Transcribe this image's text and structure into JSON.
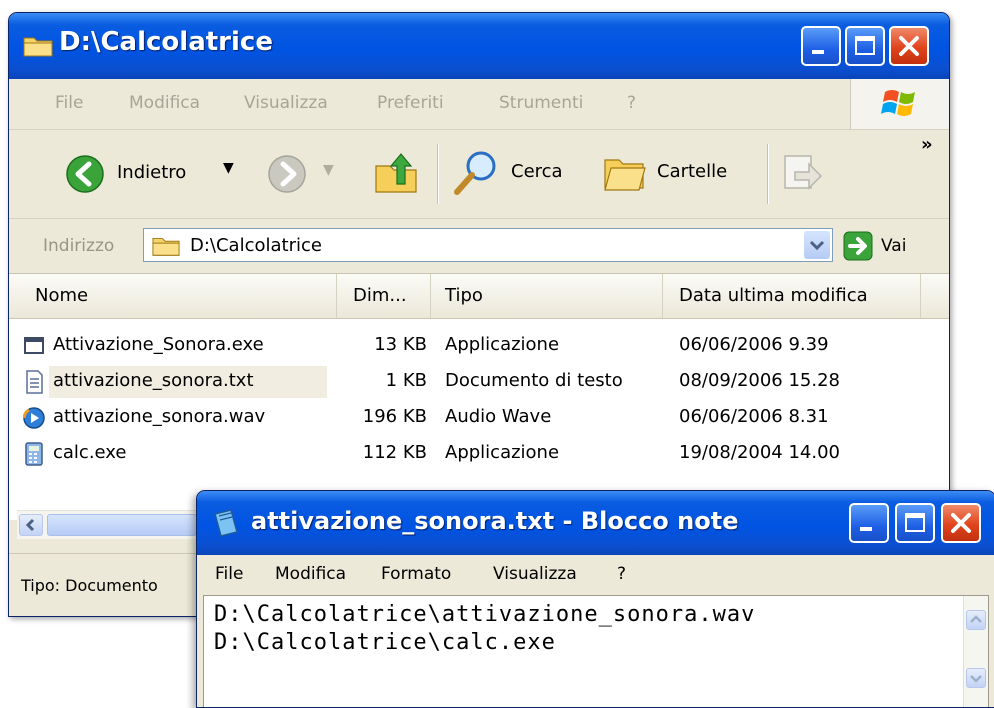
{
  "explorer": {
    "title": "D:\\Calcolatrice",
    "menu": [
      "File",
      "Modifica",
      "Visualizza",
      "Preferiti",
      "Strumenti",
      "?"
    ],
    "toolbar": {
      "back_label": "Indietro",
      "search_label": "Cerca",
      "folders_label": "Cartelle",
      "more": "»"
    },
    "address": {
      "label": "Indirizzo",
      "value": "D:\\Calcolatrice",
      "go_label": "Vai"
    },
    "columns": [
      "Nome",
      "Dim...",
      "Tipo",
      "Data ultima modifica"
    ],
    "files": [
      {
        "name": "Attivazione_Sonora.exe",
        "size": "13 KB",
        "type": "Applicazione",
        "modified": "06/06/2006 9.39",
        "icon": "exe-window-icon"
      },
      {
        "name": "attivazione_sonora.txt",
        "size": "1 KB",
        "type": "Documento di testo",
        "modified": "08/09/2006 15.28",
        "icon": "text-file-icon"
      },
      {
        "name": "attivazione_sonora.wav",
        "size": "196 KB",
        "type": "Audio Wave",
        "modified": "06/06/2006 8.31",
        "icon": "wave-audio-icon"
      },
      {
        "name": "calc.exe",
        "size": "112 KB",
        "type": "Applicazione",
        "modified": "19/08/2004 14.00",
        "icon": "calculator-icon"
      }
    ],
    "status": "Tipo: Documento"
  },
  "notepad": {
    "title": "attivazione_sonora.txt - Blocco note",
    "menu": [
      "File",
      "Modifica",
      "Formato",
      "Visualizza",
      "?"
    ],
    "lines": [
      "D:\\Calcolatrice\\attivazione_sonora.wav",
      "D:\\Calcolatrice\\calc.exe"
    ]
  },
  "colors": {
    "title_blue": "#0054e3",
    "close_red": "#e0441d",
    "chrome": "#ece9d8",
    "selection": "#f1ede1"
  }
}
